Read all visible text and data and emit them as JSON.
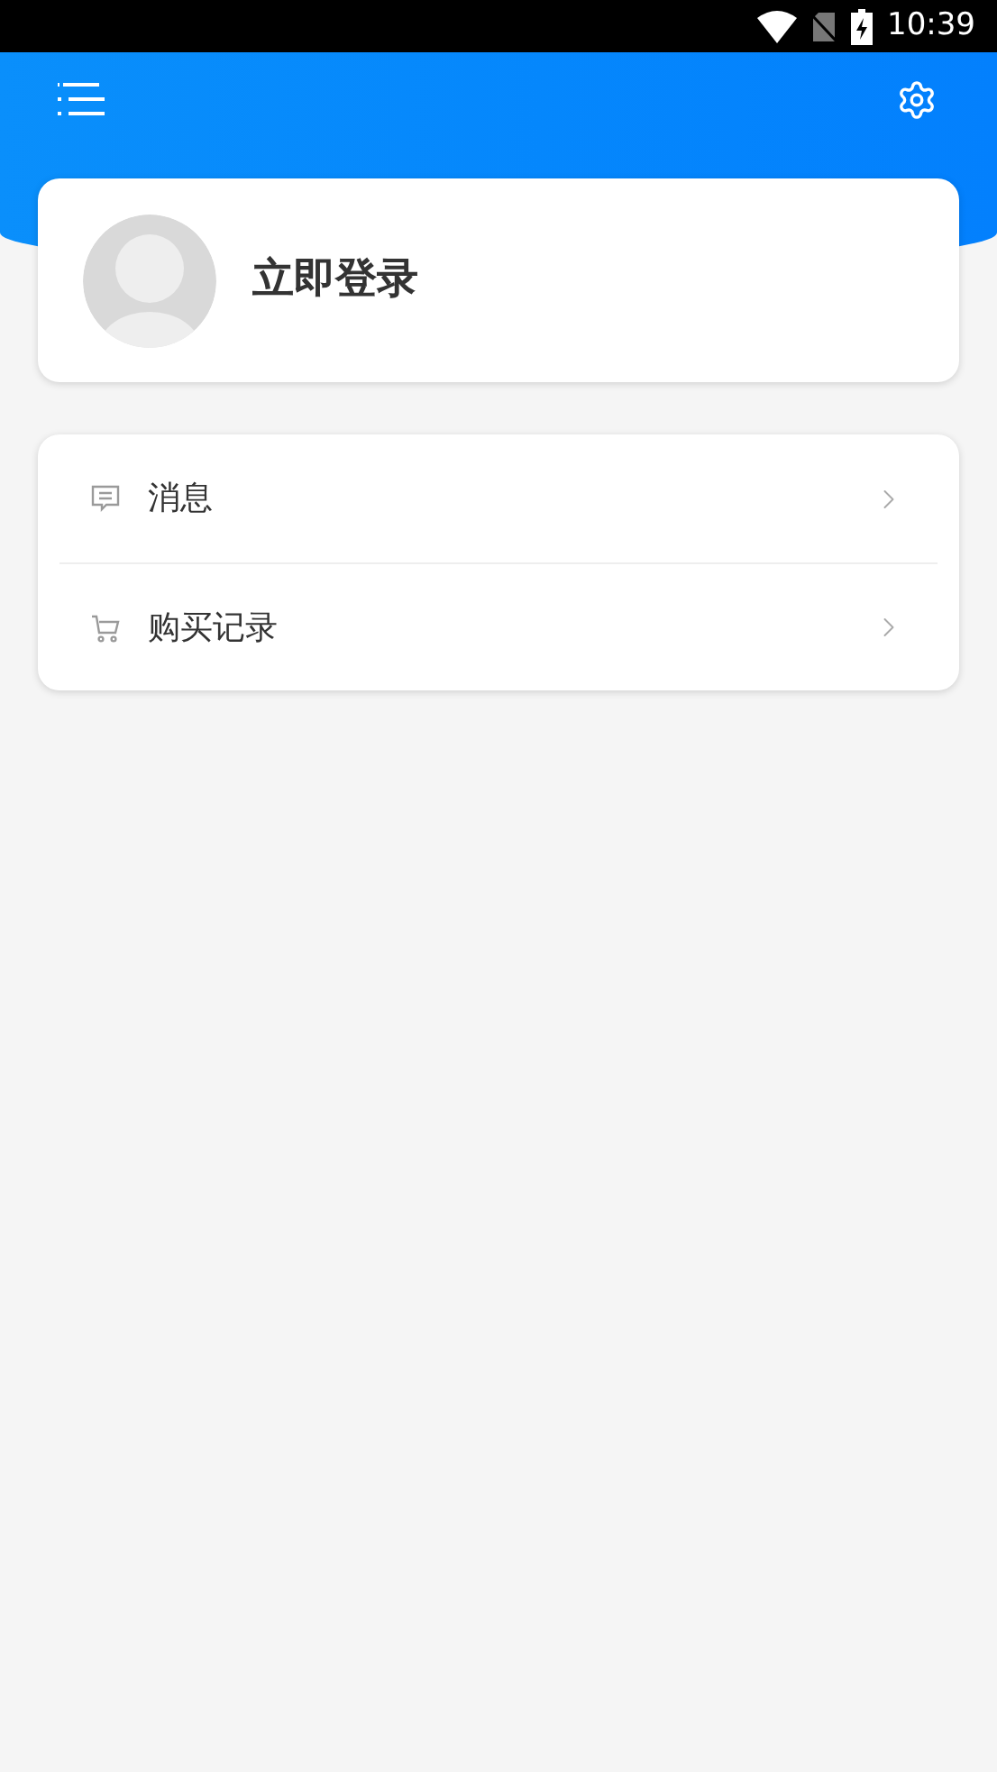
{
  "status_bar": {
    "time": "10:39"
  },
  "profile": {
    "login_label": "立即登录"
  },
  "menu": [
    {
      "kind": "message",
      "label": "消息"
    },
    {
      "kind": "cart",
      "label": "购买记录"
    }
  ]
}
